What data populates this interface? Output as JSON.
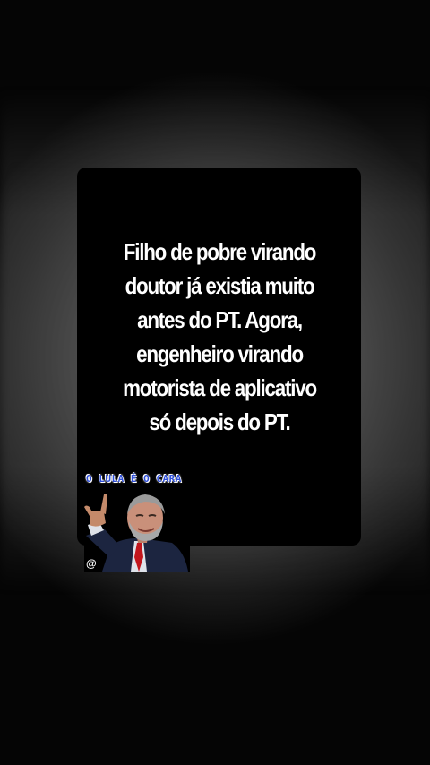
{
  "post": {
    "quote_lines": [
      "Filho de pobre virando",
      "doutor já existia muito",
      "antes do PT. Agora,",
      "engenheiro virando",
      "motorista de aplicativo",
      "só depois do PT."
    ]
  },
  "sticker": {
    "caption": "O LULA É O CARA",
    "handle": "@",
    "caption_color": "#2f4fd8"
  },
  "colors": {
    "card": "#000000",
    "text": "#ffffff"
  }
}
